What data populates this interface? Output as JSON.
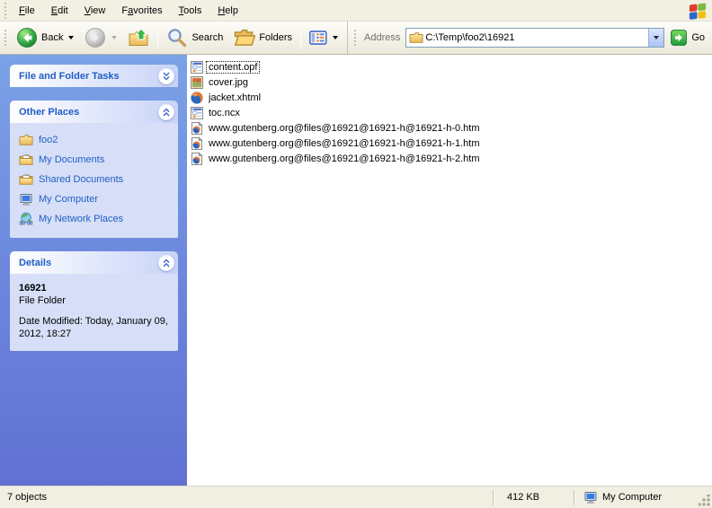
{
  "menu": {
    "items": [
      {
        "pre": "",
        "key": "F",
        "post": "ile"
      },
      {
        "pre": "",
        "key": "E",
        "post": "dit"
      },
      {
        "pre": "",
        "key": "V",
        "post": "iew"
      },
      {
        "pre": "F",
        "key": "a",
        "post": "vorites"
      },
      {
        "pre": "",
        "key": "T",
        "post": "ools"
      },
      {
        "pre": "",
        "key": "H",
        "post": "elp"
      }
    ]
  },
  "toolbar": {
    "back_label": "Back",
    "search_label": "Search",
    "folders_label": "Folders"
  },
  "address": {
    "label": "Address",
    "value": "C:\\Temp\\foo2\\16921",
    "go_label": "Go"
  },
  "sidebar": {
    "tasks_title": "File and Folder Tasks",
    "places_title": "Other Places",
    "places": [
      "foo2",
      "My Documents",
      "Shared Documents",
      "My Computer",
      "My Network Places"
    ],
    "details_title": "Details",
    "details": {
      "name": "16921",
      "type": "File Folder",
      "modified": "Date Modified: Today, January 09, 2012, 18:27"
    }
  },
  "files": [
    {
      "name": "content.opf",
      "icon": "opf-document-icon",
      "focused": true
    },
    {
      "name": "cover.jpg",
      "icon": "image-icon"
    },
    {
      "name": "jacket.xhtml",
      "icon": "firefox-icon"
    },
    {
      "name": "toc.ncx",
      "icon": "ncx-document-icon"
    },
    {
      "name": "www.gutenberg.org@files@16921@16921-h@16921-h-0.htm",
      "icon": "firefox-html-icon"
    },
    {
      "name": "www.gutenberg.org@files@16921@16921-h@16921-h-1.htm",
      "icon": "firefox-html-icon"
    },
    {
      "name": "www.gutenberg.org@files@16921@16921-h@16921-h-2.htm",
      "icon": "firefox-html-icon"
    }
  ],
  "statusbar": {
    "objects": "7 objects",
    "size": "412 KB",
    "location": "My Computer"
  }
}
